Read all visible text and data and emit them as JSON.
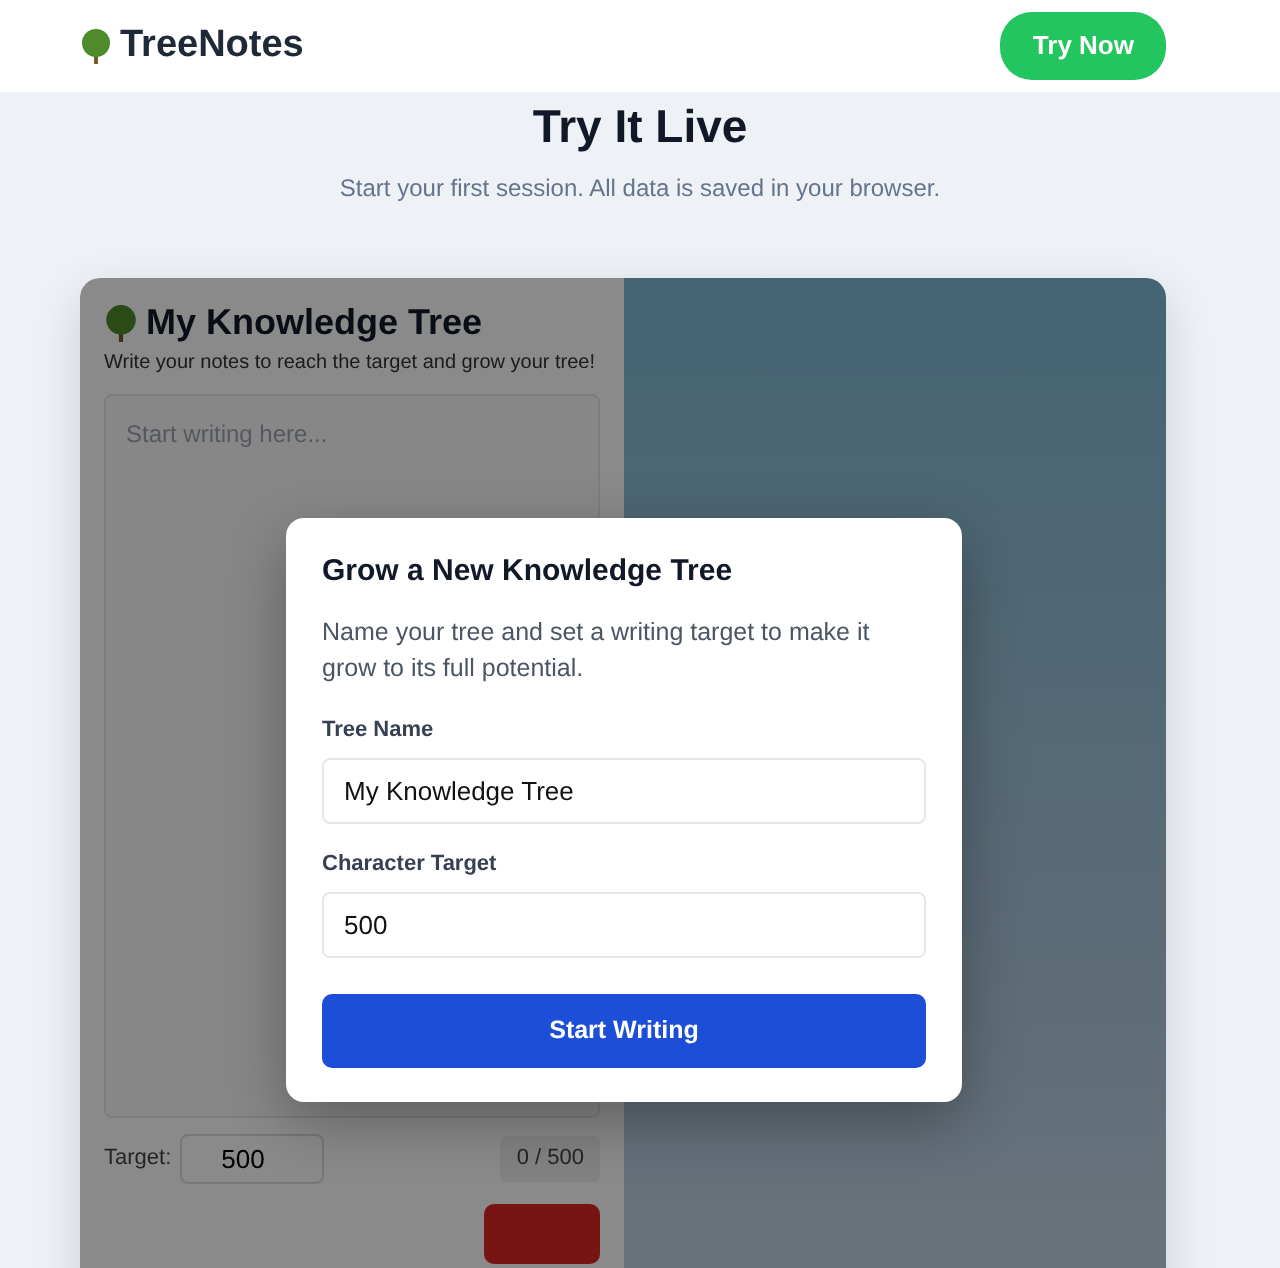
{
  "header": {
    "brand": "TreeNotes",
    "cta": "Try Now"
  },
  "hero": {
    "title": "Try It Live",
    "subtitle": "Start your first session. All data is saved in your browser."
  },
  "editor": {
    "title": "My Knowledge Tree",
    "description": "Write your notes to reach the target and grow your tree!",
    "placeholder": "Start writing here...",
    "target_label": "Target:",
    "target_value": "500",
    "counter": "0 / 500"
  },
  "modal": {
    "title": "Grow a New Knowledge Tree",
    "description": "Name your tree and set a writing target to make it grow to its full potential.",
    "fields": [
      {
        "label": "Tree Name",
        "value": "My Knowledge Tree"
      },
      {
        "label": "Character Target",
        "value": "500"
      }
    ],
    "button": "Start Writing"
  }
}
